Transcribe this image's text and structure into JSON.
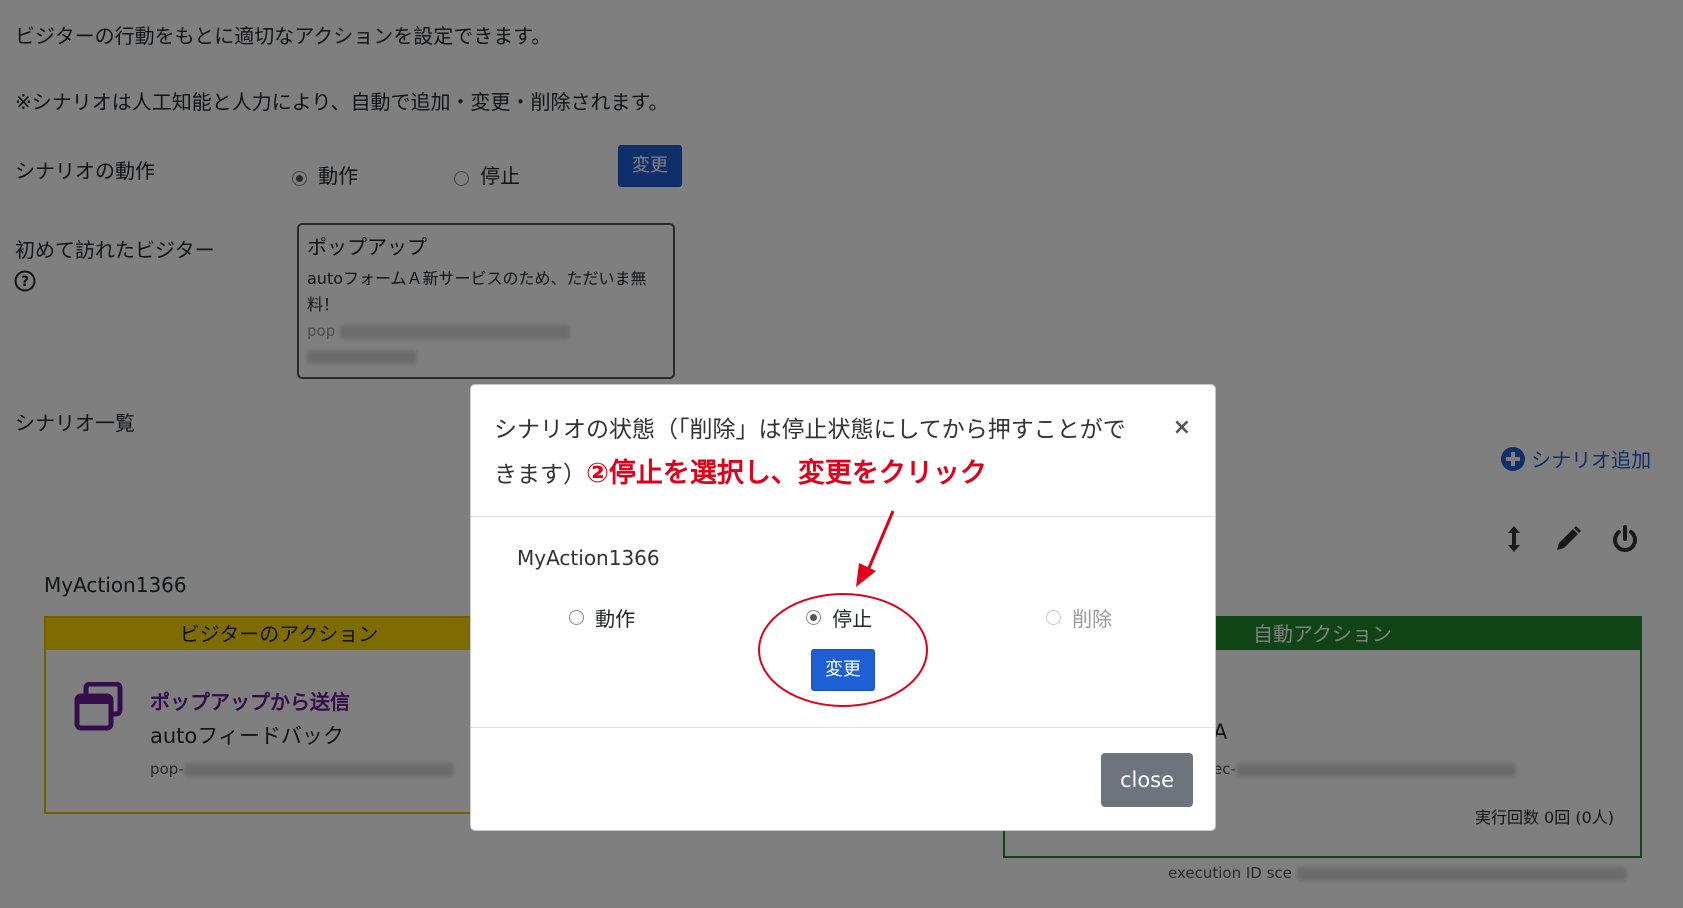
{
  "intro": {
    "line1": "ビジターの行動をもとに適切なアクションを設定できます。",
    "line2": "※シナリオは人工知能と人力により、自動で追加・変更・削除されます。"
  },
  "scenario_operation": {
    "label": "シナリオの動作",
    "options": [
      "動作",
      "停止"
    ],
    "selected": "動作",
    "change_button": "変更"
  },
  "first_visitor": {
    "label": "初めて訪れたビジター",
    "help_icon": "question-circle-icon",
    "popup": {
      "title": "ポップアップ",
      "text": "autoフォームＡ新サービスのため、ただいま無料！",
      "id_prefix": "pop"
    }
  },
  "scenario_list": {
    "label": "シナリオ一覧",
    "add_label": "シナリオ追加",
    "toolbar_icons": [
      "sort-icon",
      "pencil-icon",
      "power-icon"
    ]
  },
  "scenario": {
    "name": "MyAction1366",
    "visitor_action_header": "ビジターのアクション",
    "visitor_action_title": "ポップアップから送信",
    "visitor_action_sub": "autoフィードバック",
    "visitor_action_id_prefix": "pop-",
    "auto_action_header": "自動アクション",
    "auto_action_partial": "A",
    "auto_action_id_prefix": "ec-",
    "exec_count": "実行回数 0回 (0人)",
    "execution_id_prefix": "execution ID sce"
  },
  "modal": {
    "title": "シナリオの状態（「削除」は停止状態にしてから押すことができます）",
    "annotation": "②停止を選択し、変更をクリック",
    "scenario_name": "MyAction1366",
    "options": [
      "動作",
      "停止",
      "削除"
    ],
    "selected": "停止",
    "change_button": "変更",
    "close_button": "close",
    "close_x": "×"
  },
  "colors": {
    "primary_button": "#1f5fd6",
    "visitor_header": "#ffd800",
    "auto_header": "#1e8a2a",
    "annotation_red": "#e0001a",
    "action_purple": "#6a1b9a",
    "close_button": "#6c757d"
  }
}
